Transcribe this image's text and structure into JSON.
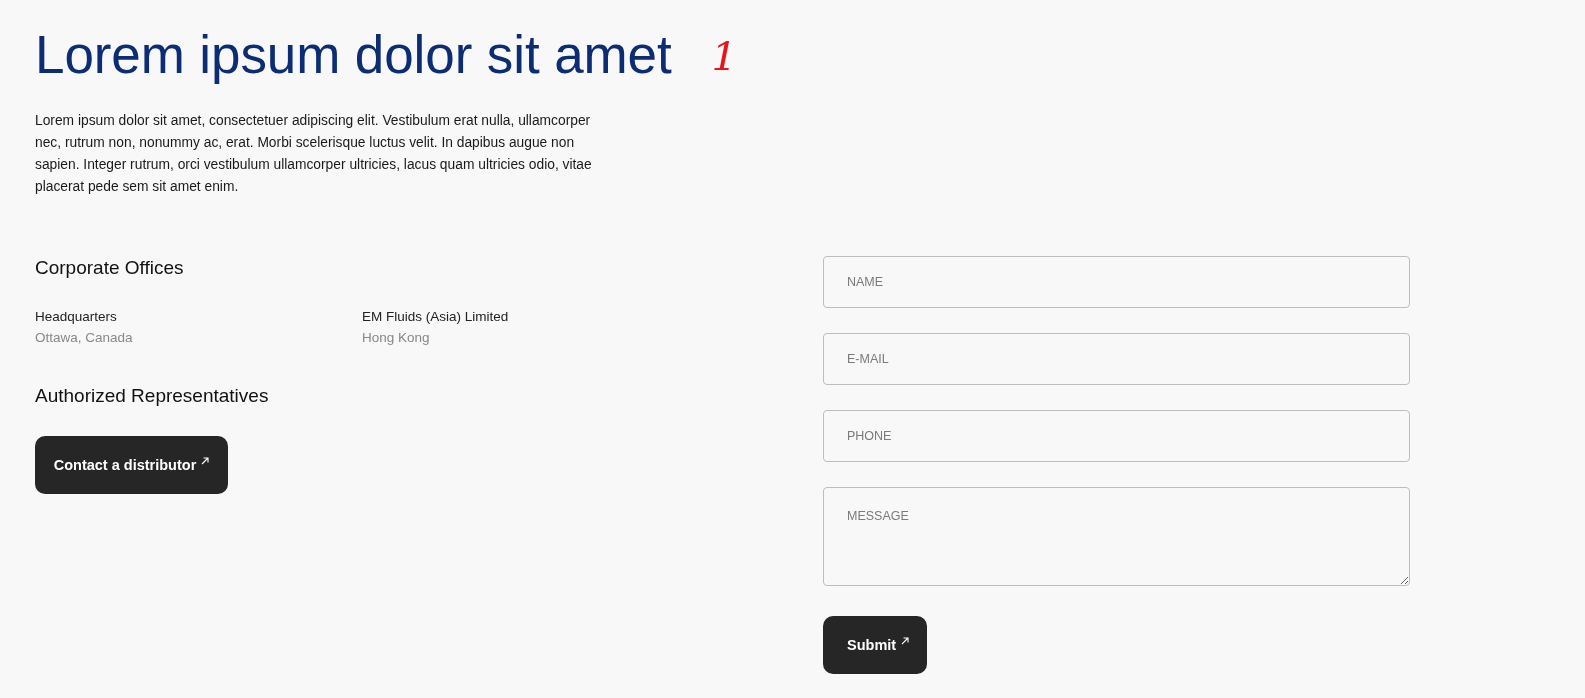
{
  "heading": {
    "title": "Lorem ipsum dolor sit amet",
    "annotation": "1"
  },
  "intro": "Lorem ipsum dolor sit amet, consectetuer adipiscing elit. Vestibulum erat nulla, ullamcorper nec, rutrum non, nonummy ac, erat. Morbi scelerisque luctus velit. In dapibus augue non sapien. Integer rutrum, orci vestibulum ullamcorper ultricies, lacus quam ultricies odio, vitae placerat pede sem sit amet enim.",
  "offices": {
    "title": "Corporate Offices",
    "items": [
      {
        "name": "Headquarters",
        "location": "Ottawa, Canada"
      },
      {
        "name": "EM Fluids (Asia) Limited",
        "location": "Hong Kong"
      }
    ]
  },
  "representatives": {
    "title": "Authorized Representatives",
    "button": "Contact a distributor"
  },
  "form": {
    "fields": [
      {
        "kind": "input",
        "placeholder": "NAME"
      },
      {
        "kind": "input",
        "placeholder": "E-MAIL"
      },
      {
        "kind": "input",
        "placeholder": "PHONE"
      },
      {
        "kind": "textarea",
        "placeholder": "MESSAGE"
      }
    ],
    "submit": "Submit"
  }
}
